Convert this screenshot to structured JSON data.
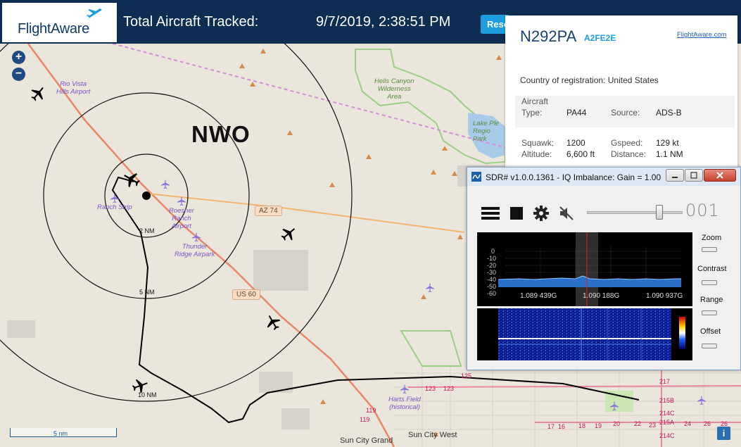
{
  "header": {
    "logo": "FlightAware",
    "title": "Total Aircraft Tracked:",
    "datetime": "9/7/2019, 2:38:51 PM",
    "reset_label": "Reset"
  },
  "map": {
    "station_label": "NWO",
    "rings": [
      "2 NM",
      "5 NM",
      "10 NM"
    ],
    "places": {
      "rio_vista": "Rio Vista\nHills Airport",
      "hells_canyon": "Hells Canyon\nWilderness\nArea",
      "lake_pleasant": "Lake Ple\nRegio\nPark",
      "ranch_strip": "Ranch Strip",
      "roesner": "Roesner\nRanch\nAirport",
      "thunder_ridge": "Thunder\nRidge Airpark",
      "harts_field": "Harts Field\n(historical)",
      "sun_city_west": "Sun City West",
      "sun_city_grand": "Sun City Grand"
    },
    "highways": {
      "az74": "AZ 74",
      "us60": "US 60"
    },
    "highway_numbers": [
      "123",
      "123",
      "125",
      "119",
      "119",
      "217",
      "215B",
      "214C",
      "215A",
      "214C",
      "17",
      "16",
      "18",
      "19",
      "20",
      "22",
      "23",
      "24",
      "26",
      "26"
    ],
    "scale_label": "5 nm",
    "zoom_in": "+",
    "zoom_out": "−",
    "info": "i"
  },
  "info_panel": {
    "registration": "N292PA",
    "hex": "A2FE2E",
    "link": "FlightAware.com",
    "country_label": "Country of registration:",
    "country": "United States",
    "aircraft_label": "Aircraft",
    "type_label": "Type:",
    "type": "PA44",
    "source_label": "Source:",
    "source": "ADS-B",
    "squawk_label": "Squawk:",
    "squawk": "1200",
    "gspeed_label": "Gspeed:",
    "gspeed": "129 kt",
    "altitude_label": "Altitude:",
    "altitude": "6,600 ft",
    "distance_label": "Distance:",
    "distance": "1.1 NM"
  },
  "sdr": {
    "title": "SDR# v1.0.0.1361 - IQ Imbalance: Gain = 1.00...",
    "freq_readout": "001",
    "db_ticks": [
      "0",
      "-10",
      "-20",
      "-30",
      "-40",
      "-50",
      "-60"
    ],
    "freq_ticks": [
      "1.089 439G",
      "1.090 188G",
      "1.090 937G"
    ],
    "controls": {
      "zoom": "Zoom",
      "contrast": "Contrast",
      "range": "Range",
      "offset": "Offset"
    },
    "icons": [
      "menu-icon",
      "stop-icon",
      "gear-icon",
      "mute-icon"
    ]
  },
  "colors": {
    "header_bg": "#0d2d53",
    "reset_bg": "#1d9de0",
    "ring": "#111111",
    "route": "#e8876a",
    "az74": "#f4b56d",
    "boundary": "#d48fd8",
    "park": "#9ccf85",
    "airport": "#8a6fe0"
  }
}
